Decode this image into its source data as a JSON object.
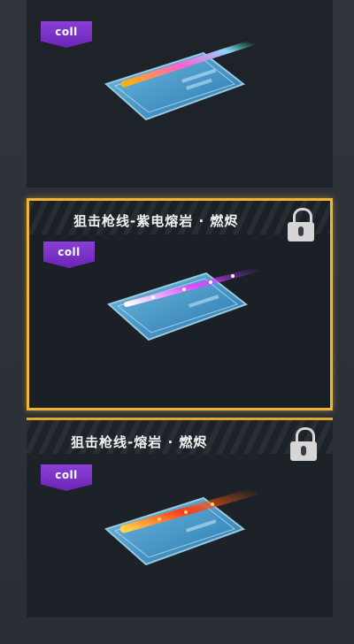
{
  "cards": [
    {
      "name": "",
      "badge": "coll",
      "locked": false,
      "selected": false,
      "beam_color": "#ff8ad8"
    },
    {
      "name": "狙击枪线-紫电熔岩 · 燃烬",
      "badge": "coll",
      "locked": true,
      "selected": true,
      "beam_color": "#e04bff"
    },
    {
      "name": "狙击枪线-熔岩 · 燃烬",
      "badge": "coll",
      "locked": true,
      "selected": false,
      "beam_color": "#ff3b1a"
    }
  ],
  "colors": {
    "selected_border": "#f0b632",
    "badge": "#7a30c8",
    "card_art": "#3aa7e6"
  },
  "icons": [
    "lock-icon",
    "badge-icon"
  ]
}
